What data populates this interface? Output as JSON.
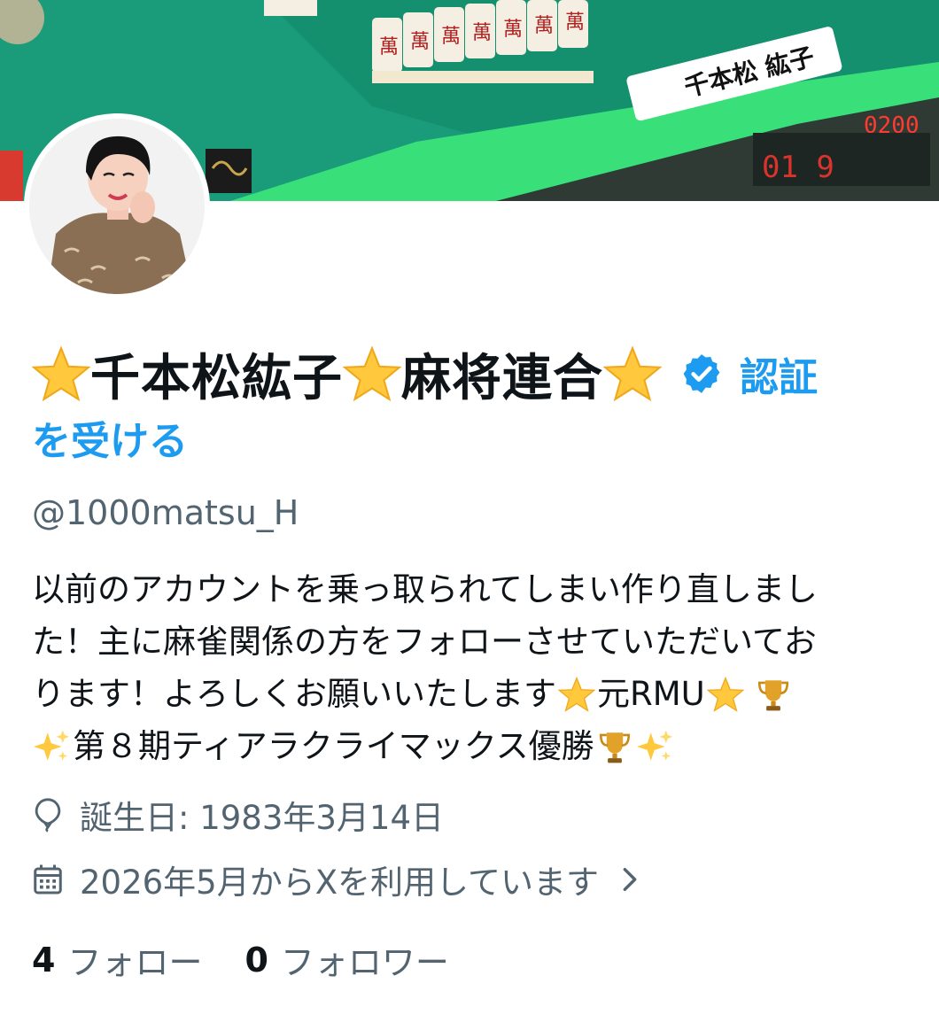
{
  "banner": {
    "name_card_text": "千本松 紘子",
    "score_text": "0200"
  },
  "profile": {
    "name_part1": "千本松紘子",
    "name_part2": "麻将連合",
    "verify_link_part1": "認証",
    "verify_link_part2": "を受ける",
    "handle": "@1000matsu_H"
  },
  "bio": {
    "line1": "以前のアカウントを乗っ取られてしまい作り直しまし",
    "line2": "た！主に麻雀関係の方をフォローさせていただいてお",
    "line3a": "ります！よろしくお願いいたします",
    "line3b": "元RMU",
    "line4": "第８期ティアラクライマックス優勝"
  },
  "meta": {
    "birthday": "誕生日: 1983年3月14日",
    "joined": "2026年5月からXを利用しています"
  },
  "follow": {
    "following_count": "4",
    "following_label": "フォロー",
    "followers_count": "0",
    "followers_label": "フォロワー"
  },
  "icons": {
    "verified": "verified-badge-icon",
    "birthday": "balloon-icon",
    "joined": "calendar-icon",
    "chevron": "chevron-right-icon",
    "star": "star-emoji-icon",
    "trophy": "trophy-emoji-icon",
    "sparkles": "sparkles-emoji-icon"
  },
  "colors": {
    "accent": "#1d9bf0",
    "text": "#0f1419",
    "muted": "#536471",
    "star": "#ffc83d"
  }
}
